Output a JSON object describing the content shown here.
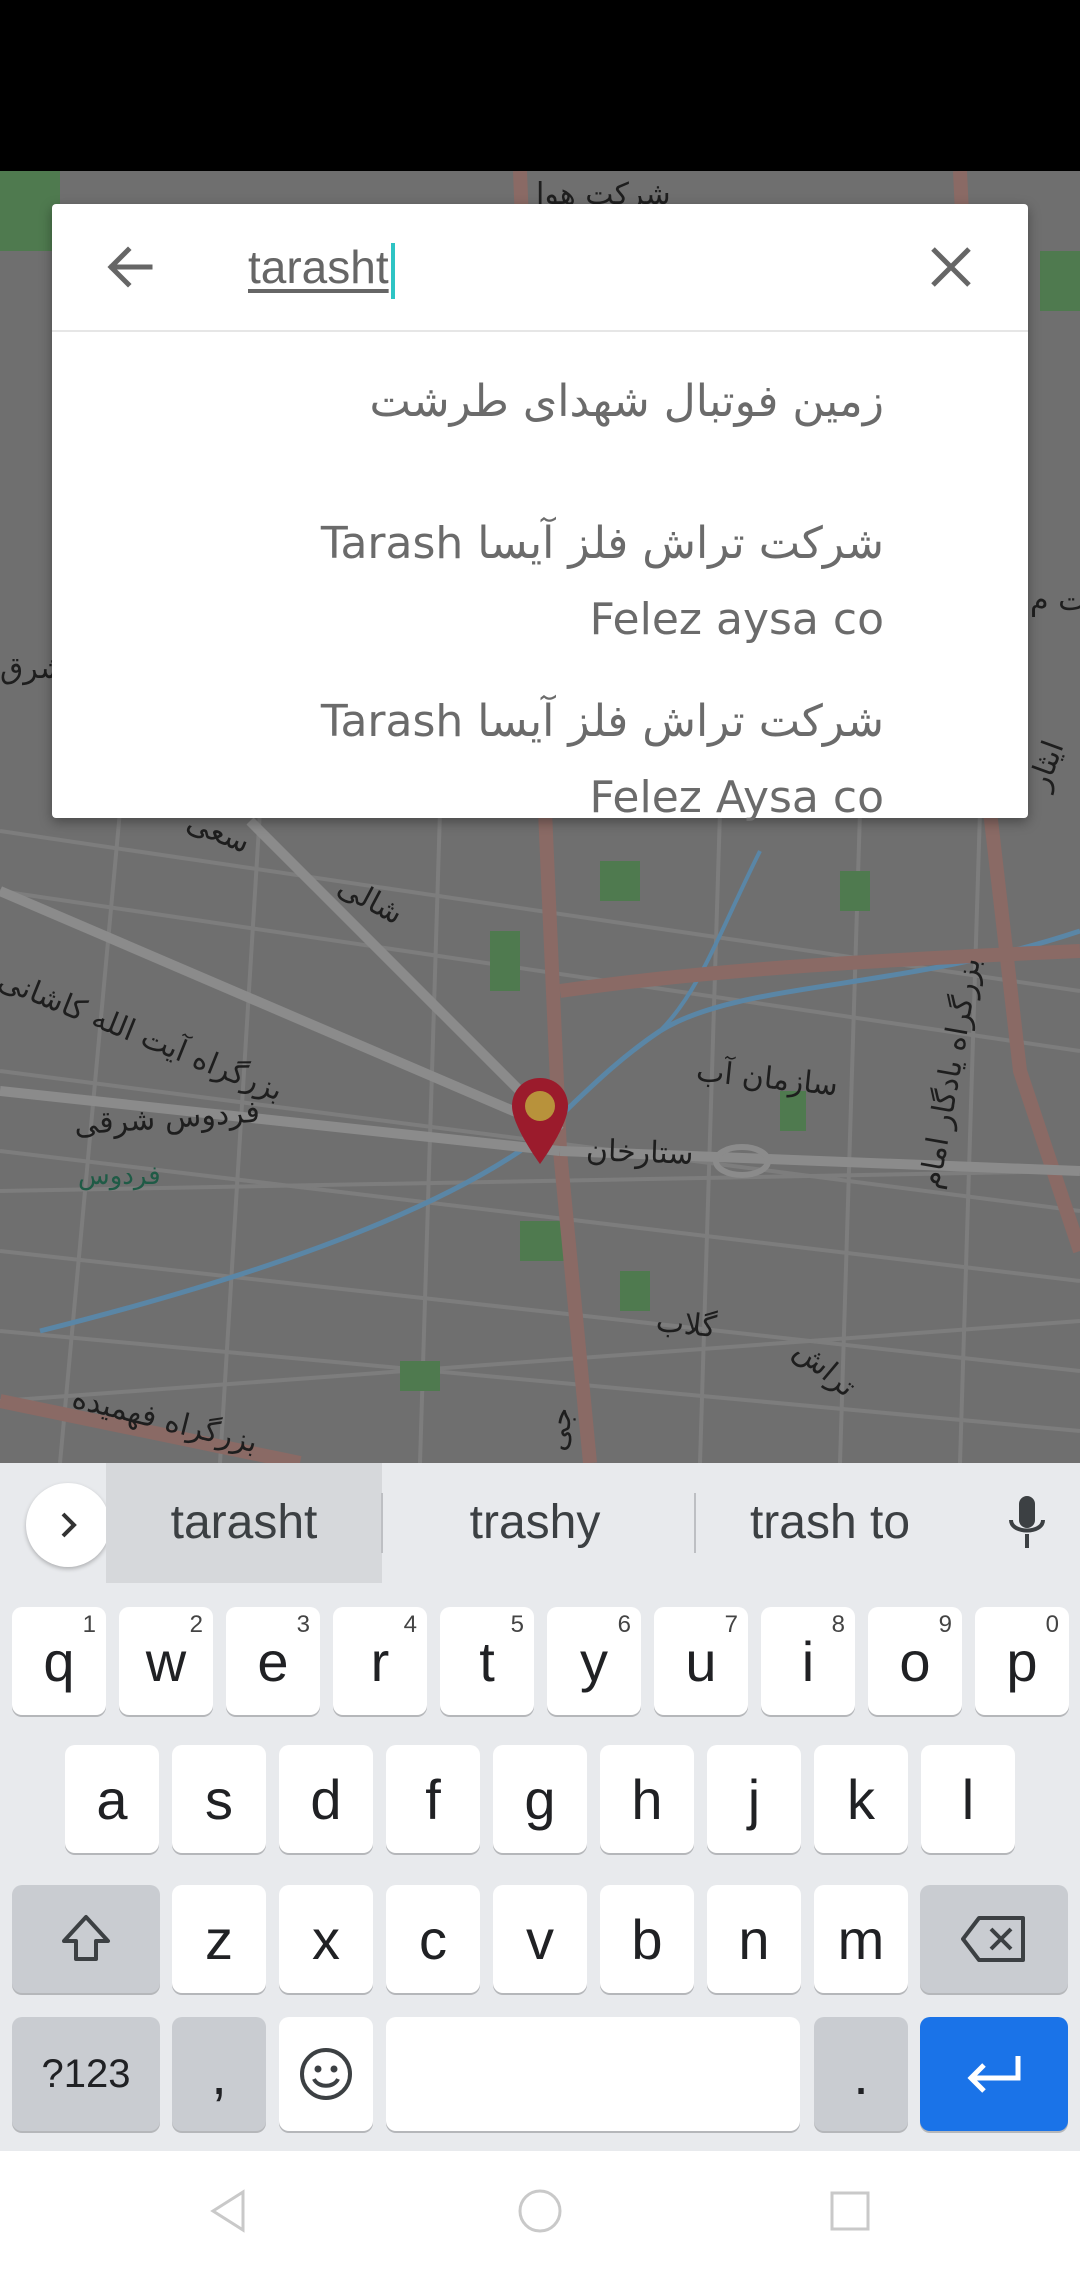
{
  "search": {
    "query": "tarasht",
    "suggestions": [
      {
        "line1": "زمین فوتبال شهدای طرشت"
      },
      {
        "line1": "شرکت تراش فلز آیسا Tarash",
        "line2": "Felez aysa co"
      },
      {
        "line1": "شرکت تراش فلز آیسا Tarash",
        "line2": "Felez Aysa co"
      }
    ]
  },
  "map": {
    "labels": [
      "شالی",
      "بزرگراه آیت الله کاشانی",
      "فردوس شرقی",
      "فردوس",
      "سازمان آب",
      "ستارخان",
      "گلاب",
      "بزرگراه فهمیده",
      "بزرگراه یادگار امام",
      "شرکت هوا",
      "ایثار",
      "ت م",
      "شرق",
      "جی",
      "تراش",
      "سعی"
    ],
    "pin_color": "#9b1b2c"
  },
  "keyboard": {
    "suggestions": [
      "tarasht",
      "trashy",
      "trash to"
    ],
    "row1": [
      {
        "k": "q",
        "h": "1"
      },
      {
        "k": "w",
        "h": "2"
      },
      {
        "k": "e",
        "h": "3"
      },
      {
        "k": "r",
        "h": "4"
      },
      {
        "k": "t",
        "h": "5"
      },
      {
        "k": "y",
        "h": "6"
      },
      {
        "k": "u",
        "h": "7"
      },
      {
        "k": "i",
        "h": "8"
      },
      {
        "k": "o",
        "h": "9"
      },
      {
        "k": "p",
        "h": "0"
      }
    ],
    "row2": [
      "a",
      "s",
      "d",
      "f",
      "g",
      "h",
      "j",
      "k",
      "l"
    ],
    "row3": [
      "z",
      "x",
      "c",
      "v",
      "b",
      "n",
      "m"
    ],
    "symbols_label": "?123",
    "comma": ",",
    "period": ".",
    "accent_color": "#1a73e8"
  }
}
